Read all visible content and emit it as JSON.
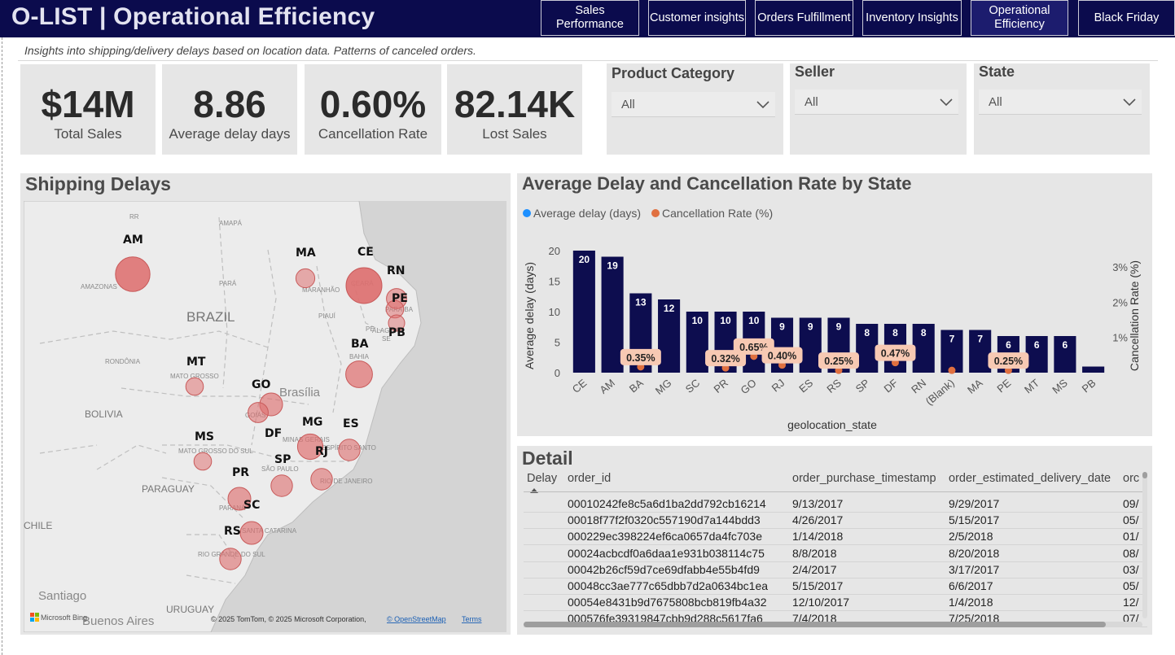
{
  "app": {
    "title": "O-LIST | Operational Efficiency",
    "subtitle": "Insights into shipping/delivery delays based on location data. Patterns of canceled orders."
  },
  "nav": [
    {
      "label": "Sales Performance",
      "active": false
    },
    {
      "label": "Customer insights",
      "active": false
    },
    {
      "label": "Orders Fulfillment",
      "active": false
    },
    {
      "label": "Inventory Insights",
      "active": false
    },
    {
      "label": "Operational Efficiency",
      "active": true
    },
    {
      "label": "Black Friday",
      "active": false
    }
  ],
  "kpis": [
    {
      "value": "$14M",
      "label": "Total Sales"
    },
    {
      "value": "8.86",
      "label": "Average delay days"
    },
    {
      "value": "0.60%",
      "label": "Cancellation Rate"
    },
    {
      "value": "82.14K",
      "label": "Lost Sales"
    }
  ],
  "slicers": [
    {
      "title": "Product Category",
      "value": "All"
    },
    {
      "title": "Seller",
      "value": "All"
    },
    {
      "title": "State",
      "value": "All"
    }
  ],
  "map": {
    "title": "Shipping Delays",
    "attribution": "© 2025 TomTom, © 2025 Microsoft Corporation, ",
    "osm_link": "© OpenStreetMap",
    "terms_link": "Terms",
    "logo_text": "Microsoft Bing",
    "country_labels": [
      "BRAZIL",
      "BOLIVIA",
      "PARAGUAY",
      "CHILE",
      "URUGUAY"
    ],
    "city_labels": [
      "Brasília",
      "Santiago",
      "Buenos Aires"
    ],
    "region_labels": [
      "RR",
      "AMAPÁ",
      "AMAZONAS",
      "PARÁ",
      "MARANHÃO",
      "PIAUÍ",
      "CEARÁ",
      "PARAÍBA",
      "ALAGOAS",
      "SE",
      "PE",
      "BAHIA",
      "RONDÔNIA",
      "MATO GROSSO",
      "GOIÁS",
      "MINAS GERAIS",
      "ESPÍRITO SANTO",
      "MATO GROSSO DO SUL",
      "SÃO PAULO",
      "RIO DE JANEIRO",
      "PARANÁ",
      "SANTA CATARINA",
      "RIO GRANDE DO SUL"
    ],
    "bubbles": [
      {
        "state": "AM",
        "delay": 19
      },
      {
        "state": "MA",
        "delay": 7
      },
      {
        "state": "CE",
        "delay": 20
      },
      {
        "state": "RN",
        "delay": 8
      },
      {
        "state": "PE",
        "delay": 6
      },
      {
        "state": "PB",
        "delay": 5
      },
      {
        "state": "BA",
        "delay": 13
      },
      {
        "state": "MT",
        "delay": 6
      },
      {
        "state": "GO",
        "delay": 10
      },
      {
        "state": "DF",
        "delay": 8
      },
      {
        "state": "MG",
        "delay": 12
      },
      {
        "state": "ES",
        "delay": 9
      },
      {
        "state": "MS",
        "delay": 6
      },
      {
        "state": "RJ",
        "delay": 9
      },
      {
        "state": "SP",
        "delay": 9
      },
      {
        "state": "PR",
        "delay": 10
      },
      {
        "state": "SC",
        "delay": 10
      },
      {
        "state": "RS",
        "delay": 9
      }
    ]
  },
  "chart_data": {
    "type": "bar",
    "title": "Average Delay and Cancellation Rate by State",
    "xlabel": "geolocation_state",
    "ylabel": "Average delay (days)",
    "y2label": "Cancellation Rate (%)",
    "ylim": [
      0,
      20
    ],
    "y2lim": [
      0,
      3
    ],
    "yticks": [
      "0",
      "5",
      "10",
      "15",
      "20"
    ],
    "y2ticks": [
      "1%",
      "2%",
      "3%"
    ],
    "legend_position": "top-left",
    "categories": [
      "CE",
      "AM",
      "BA",
      "MG",
      "SC",
      "PR",
      "GO",
      "RJ",
      "ES",
      "RS",
      "SP",
      "DF",
      "RN",
      "(Blank)",
      "MA",
      "PE",
      "MT",
      "MS",
      "PB"
    ],
    "series": [
      {
        "name": "Average delay (days)",
        "color": "#0d0d4f",
        "values": [
          20,
          19,
          13,
          12,
          10,
          10,
          10,
          9,
          9,
          9,
          8,
          8,
          8,
          7,
          7,
          6,
          6,
          6,
          1
        ],
        "labels": [
          "20",
          "19",
          "13",
          "12",
          "10",
          "10",
          "10",
          "9",
          "9",
          "9",
          "8",
          "8",
          "8",
          "7",
          "7",
          "6",
          "6",
          "6",
          ""
        ]
      },
      {
        "name": "Cancellation Rate (%)",
        "color": "#e07040",
        "values": [
          null,
          null,
          0.35,
          null,
          null,
          0.32,
          0.65,
          0.4,
          null,
          0.25,
          null,
          0.47,
          null,
          0.25,
          null,
          0.25,
          null,
          null,
          null
        ],
        "labels": [
          "",
          "",
          "0.35%",
          "",
          "",
          "0.32%",
          "0.65%",
          "0.40%",
          "",
          "0.25%",
          "",
          "0.47%",
          "",
          "",
          "",
          "0.25%",
          "",
          "",
          ""
        ]
      }
    ]
  },
  "detail": {
    "title": "Detail",
    "columns": [
      "Delay",
      "order_id",
      "order_purchase_timestamp",
      "order_estimated_delivery_date",
      "orc"
    ],
    "rows": [
      [
        "00010242fe8c5a6d1ba2dd792cb16214",
        "9/13/2017",
        "9/29/2017",
        "09/"
      ],
      [
        "00018f77f2f0320c557190d7a144bdd3",
        "4/26/2017",
        "5/15/2017",
        "05/"
      ],
      [
        "000229ec398224ef6ca0657da4fc703e",
        "1/14/2018",
        "2/5/2018",
        "01/"
      ],
      [
        "00024acbcdf0a6daa1e931b038114c75",
        "8/8/2018",
        "8/20/2018",
        "08/"
      ],
      [
        "00042b26cf59d7ce69dfabb4e55b4fd9",
        "2/4/2017",
        "3/17/2017",
        "03/"
      ],
      [
        "00048cc3ae777c65dbb7d2a0634bc1ea",
        "5/15/2017",
        "6/6/2017",
        "05/"
      ],
      [
        "00054e8431b9d7675808bcb819fb4a32",
        "12/10/2017",
        "1/4/2018",
        "12/"
      ],
      [
        "000576fe39319847cbb9d288c5617fa6",
        "7/4/2018",
        "7/25/2018",
        "07/"
      ]
    ]
  }
}
